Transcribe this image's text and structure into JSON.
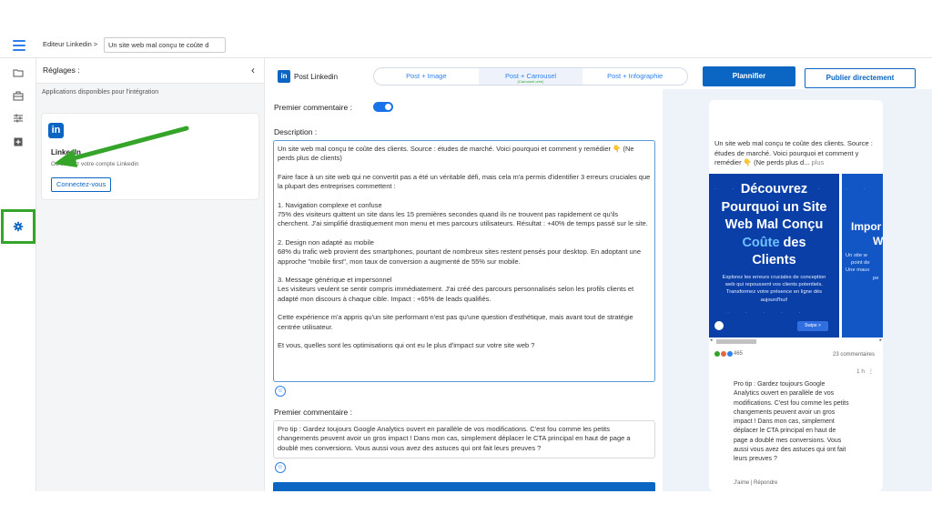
{
  "header": {
    "breadcrumb": "Editeur Linkedin >",
    "doc_title": "Un site web mal conçu te coûte d"
  },
  "sidebar": {
    "icons": [
      "folder-icon",
      "briefcase-icon",
      "sliders-icon",
      "plus-square-icon",
      "gear-icon"
    ]
  },
  "settings_panel": {
    "title": "Réglages :",
    "subtitle": "Applications disponibles pour l'intégration",
    "integration": {
      "logo": "in",
      "name": "LinkedIn",
      "description": "Connectez votre compte Linkedin",
      "button": "Connectez-vous"
    }
  },
  "editor": {
    "post_type_label": "Post Linkedin",
    "tabs": [
      {
        "label": "Post + Image",
        "sub": ""
      },
      {
        "label": "Post + Carrousel",
        "sub": "(Carrousel créé)"
      },
      {
        "label": "Post + Infographie",
        "sub": ""
      }
    ],
    "active_tab": 1,
    "schedule_button": "Plannifier",
    "publish_button": "Publier directement",
    "first_comment_toggle_label": "Premier commentaire :",
    "first_comment_enabled": true,
    "description_label": "Description :",
    "description_paragraphs": [
      "Un site web mal conçu te coûte des clients. Source : études de marché. Voici pourquoi et comment y remédier 👇 (Ne perds plus de clients)",
      "Faire face à un site web qui ne convertit pas a été un véritable défi, mais cela m'a permis d'identifier 3 erreurs cruciales que la plupart des entreprises commettent :",
      "1. Navigation complexe et confuse\n75% des visiteurs quittent un site dans les 15 premières secondes quand ils ne trouvent pas rapidement ce qu'ils cherchent. J'ai simplifié drastiquement mon menu et mes parcours utilisateurs. Résultat : +40% de temps passé sur le site.",
      "2. Design non adapté au mobile\n68% du trafic web provient des smartphones, pourtant de nombreux sites restent pensés pour desktop. En adoptant une approche \"mobile first\", mon taux de conversion a augmenté de 55% sur mobile.",
      "3. Message générique et impersonnel\nLes visiteurs veulent se sentir compris immédiatement. J'ai créé des parcours personnalisés selon les profils clients et adapté mon discours à chaque cible. Impact : +65% de leads qualifiés.",
      "Cette expérience m'a appris qu'un site performant n'est pas qu'une question d'esthétique, mais avant tout de stratégie centrée utilisateur.",
      "Et vous, quelles sont les optimisations qui ont eu le plus d'impact sur votre site web ?"
    ],
    "first_comment_label": "Premier commentaire :",
    "first_comment_text": "Pro tip : Gardez toujours Google Analytics ouvert en parallèle de vos modifications. C'est fou comme les petits changements peuvent avoir un gros impact ! Dans mon cas, simplement déplacer le CTA principal en haut de page a doublé mes conversions. Vous aussi vous avez des astuces qui ont fait leurs preuves ?"
  },
  "preview": {
    "post_text": "Un site web mal conçu te coûte des clients. Source : études de marché. Voici pourquoi et comment y remédier 👇 (Ne perds plus d...",
    "more": "plus",
    "slide1": {
      "title_line1": "Découvrez",
      "title_line2": "Pourquoi un Site",
      "title_line3": "Web Mal Conçu",
      "title_highlight": "Coûte",
      "title_rest": " des",
      "title_line5": "Clients",
      "desc": "Explorez les erreurs cruciales de conception web qui repoussent vos clients potentiels. Transformez votre présence en ligne dès aujourd'hui!",
      "swipe": "Swipe >"
    },
    "slide2": {
      "title_line1": "Impor",
      "title_line2": "W",
      "desc_line1": "Un site w",
      "desc_line2": "point de",
      "desc_line3": "Une mauv",
      "desc_line4": "pe"
    },
    "reactions_count": "465",
    "comments_count": "23 commentaires",
    "comment_time": "1 h",
    "comment_menu": "⋮",
    "comment_text": "Pro tip : Gardez toujours Google Analytics ouvert en parallèle de vos modifications. C'est fou comme les petits changements peuvent avoir un gros impact ! Dans mon cas, simplement déplacer le CTA principal en haut de page a doublé mes conversions. Vous aussi vous avez des astuces qui ont fait leurs preuves ?",
    "comment_actions": "J'aime | Répondre"
  },
  "colors": {
    "linkedin_blue": "#0a66c2",
    "accent_blue": "#2f80ed",
    "highlight_green": "#35a52a"
  }
}
